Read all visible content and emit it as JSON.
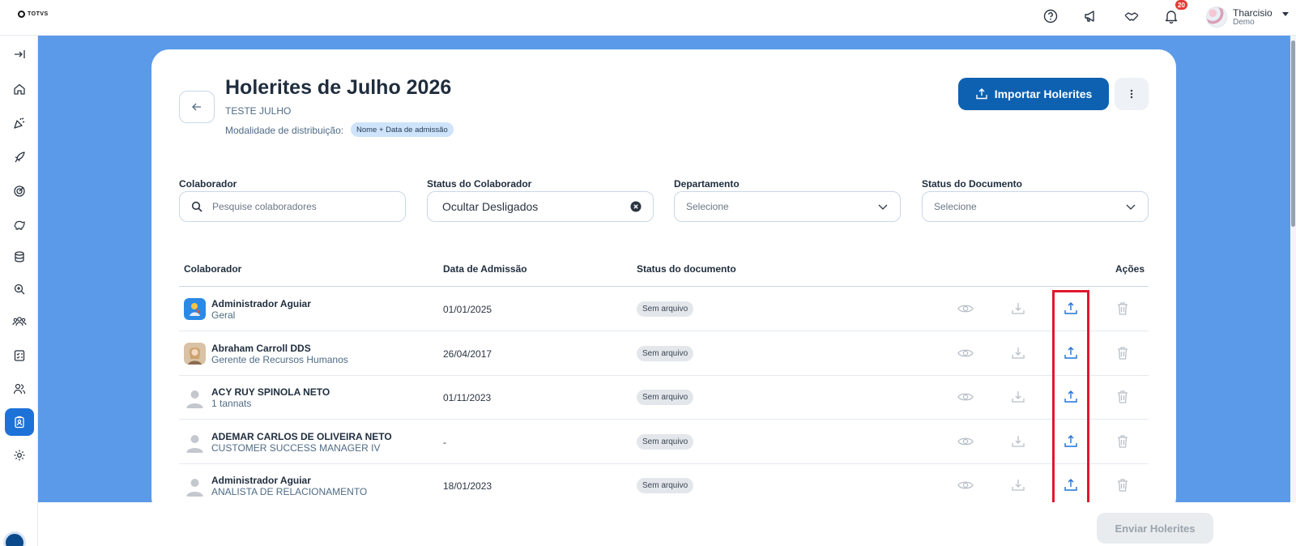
{
  "brand": {
    "logo_text": "TOTVS"
  },
  "topbar": {
    "icons": [
      "help-icon",
      "megaphone-icon",
      "handshake-icon",
      "bell-icon"
    ],
    "notification_count": "20",
    "user": {
      "name": "Tharcisio",
      "subtitle": "Demo"
    }
  },
  "sidebar": {
    "items": [
      {
        "name": "expand",
        "icon": "expand-icon"
      },
      {
        "name": "home",
        "icon": "home-icon"
      },
      {
        "name": "celebrate",
        "icon": "party-icon"
      },
      {
        "name": "launch",
        "icon": "rocket-icon"
      },
      {
        "name": "goals",
        "icon": "target-icon"
      },
      {
        "name": "benefits",
        "icon": "piggy-bank-icon"
      },
      {
        "name": "database",
        "icon": "database-icon"
      },
      {
        "name": "search",
        "icon": "zoom-icon"
      },
      {
        "name": "teams",
        "icon": "team-icon"
      },
      {
        "name": "checklist",
        "icon": "checklist-icon"
      },
      {
        "name": "people",
        "icon": "people-icon"
      },
      {
        "name": "payslips",
        "icon": "badge-icon",
        "active": true
      },
      {
        "name": "settings",
        "icon": "gear-icon"
      }
    ]
  },
  "header": {
    "title": "Holerites de Julho 2026",
    "subtitle": "TESTE JULHO",
    "modality_label": "Modalidade de distribuição:",
    "modality_value": "Nome + Data de admissão",
    "import_label": "Importar Holerites"
  },
  "filters": {
    "collaborator": {
      "label": "Colaborador",
      "placeholder": "Pesquise colaboradores"
    },
    "collaborator_status": {
      "label": "Status do Colaborador",
      "value": "Ocultar Desligados"
    },
    "department": {
      "label": "Departamento",
      "placeholder": "Selecione"
    },
    "document_status": {
      "label": "Status do Documento",
      "placeholder": "Selecione"
    }
  },
  "table": {
    "columns": [
      "Colaborador",
      "Data de Admissão",
      "Status do documento",
      "Ações"
    ],
    "rows": [
      {
        "name": "Administrador Aguiar",
        "role": "Geral",
        "admission": "01/01/2025",
        "status": "Sem arquivo",
        "avatar": "app"
      },
      {
        "name": "Abraham Carroll DDS",
        "role": "Gerente de Recursos Humanos",
        "admission": "26/04/2017",
        "status": "Sem arquivo",
        "avatar": "photo"
      },
      {
        "name": "ACY RUY SPINOLA NETO",
        "role": "1 tannats",
        "admission": "01/11/2023",
        "status": "Sem arquivo",
        "avatar": "default"
      },
      {
        "name": "ADEMAR CARLOS DE OLIVEIRA NETO",
        "role": "CUSTOMER SUCCESS MANAGER IV",
        "admission": "-",
        "status": "Sem arquivo",
        "avatar": "default"
      },
      {
        "name": "Administrador Aguiar",
        "role": "ANALISTA DE RELACIONAMENTO",
        "admission": "18/01/2023",
        "status": "Sem arquivo",
        "avatar": "default"
      }
    ]
  },
  "footer": {
    "send_label": "Enviar Holerites"
  },
  "colors": {
    "primary": "#0d61b0",
    "background": "#5a9ae8",
    "upload_action": "#1d72d8",
    "highlight": "#e0182d"
  }
}
